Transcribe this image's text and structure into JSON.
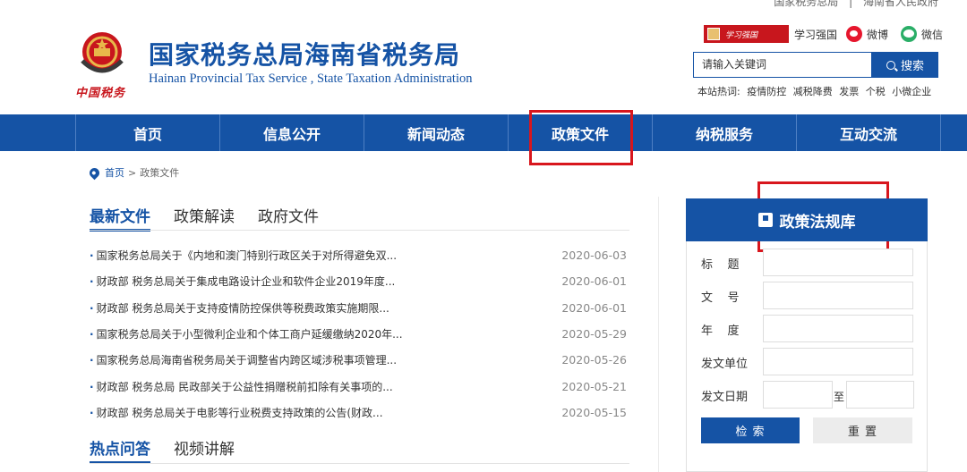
{
  "topbar": {
    "links": [
      "国家税务总局",
      "海南省人民政府"
    ],
    "separator": "|"
  },
  "header": {
    "title": "国家税务总局海南省税务局",
    "subtitle": "Hainan Provincial Tax Service , State Taxation Administration",
    "emblem_text": "中国税务"
  },
  "social": {
    "xuexi": "学习强国",
    "weibo": "微博",
    "weixin": "微信"
  },
  "search": {
    "placeholder": "请输入关键词",
    "button": "搜索"
  },
  "hotwords": {
    "label": "本站热词:",
    "items": [
      "疫情防控",
      "减税降费",
      "发票",
      "个税",
      "小微企业"
    ]
  },
  "nav": {
    "items": [
      "首页",
      "信息公开",
      "新闻动态",
      "政策文件",
      "纳税服务",
      "互动交流"
    ]
  },
  "breadcrumb": {
    "home": "首页",
    "sep": ">",
    "current": "政策文件"
  },
  "tabs": [
    "最新文件",
    "政策解读",
    "政府文件"
  ],
  "documents": [
    {
      "title": "国家税务总局关于《内地和澳门特别行政区关于对所得避免双...",
      "date": "2020-06-03"
    },
    {
      "title": "财政部 税务总局关于集成电路设计企业和软件企业2019年度...",
      "date": "2020-06-01"
    },
    {
      "title": "财政部 税务总局关于支持疫情防控保供等税费政策实施期限...",
      "date": "2020-06-01"
    },
    {
      "title": "国家税务总局关于小型微利企业和个体工商户延缓缴纳2020年...",
      "date": "2020-05-29"
    },
    {
      "title": "国家税务总局海南省税务局关于调整省内跨区域涉税事项管理...",
      "date": "2020-05-26"
    },
    {
      "title": "财政部 税务总局 民政部关于公益性捐赠税前扣除有关事项的...",
      "date": "2020-05-21"
    },
    {
      "title": "财政部 税务总局关于电影等行业税费支持政策的公告(财政...",
      "date": "2020-05-15"
    }
  ],
  "tabs2": [
    "热点问答",
    "视频讲解"
  ],
  "panel": {
    "title": "政策法规库",
    "fields": {
      "title": "标    题",
      "doc_no": "文    号",
      "year": "年    度",
      "issuer": "发文单位",
      "date": "发文日期",
      "to": "至"
    },
    "search_btn": "检 索",
    "reset_btn": "重 置"
  }
}
